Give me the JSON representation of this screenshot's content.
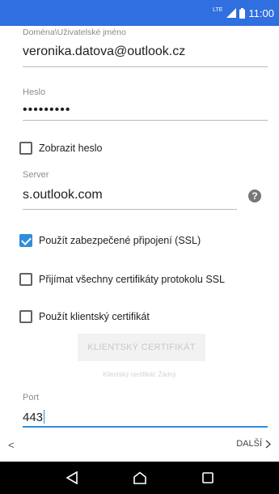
{
  "status": {
    "network": "LTE",
    "time": "11:00"
  },
  "form": {
    "username": {
      "label": "Doména\\Uživatelské jméno",
      "value": "veronika.datova@outlook.cz"
    },
    "password": {
      "label": "Heslo",
      "value": "•••••••••"
    },
    "show_password": {
      "label": "Zobrazit heslo",
      "checked": false
    },
    "server": {
      "label": "Server",
      "value": "s.outlook.com",
      "help_icon": "help-icon"
    },
    "ssl": {
      "label": "Použít zabezpečené připojení (SSL)",
      "checked": true
    },
    "accept_certs": {
      "label": "Přijímat všechny certifikáty protokolu SSL",
      "checked": false
    },
    "client_cert": {
      "label": "Použít klientský certifikát",
      "checked": false
    },
    "client_cert_button": "KLIENTSKÝ CERTIFIKÁT",
    "client_cert_status": "Klientský certifikát: Žádný",
    "port": {
      "label": "Port",
      "value": "443"
    }
  },
  "nav": {
    "prev_label": "<",
    "next_label": "DALŠÍ"
  },
  "colors": {
    "status_bar": "#2f6fe0",
    "accent": "#2f8ddc"
  }
}
